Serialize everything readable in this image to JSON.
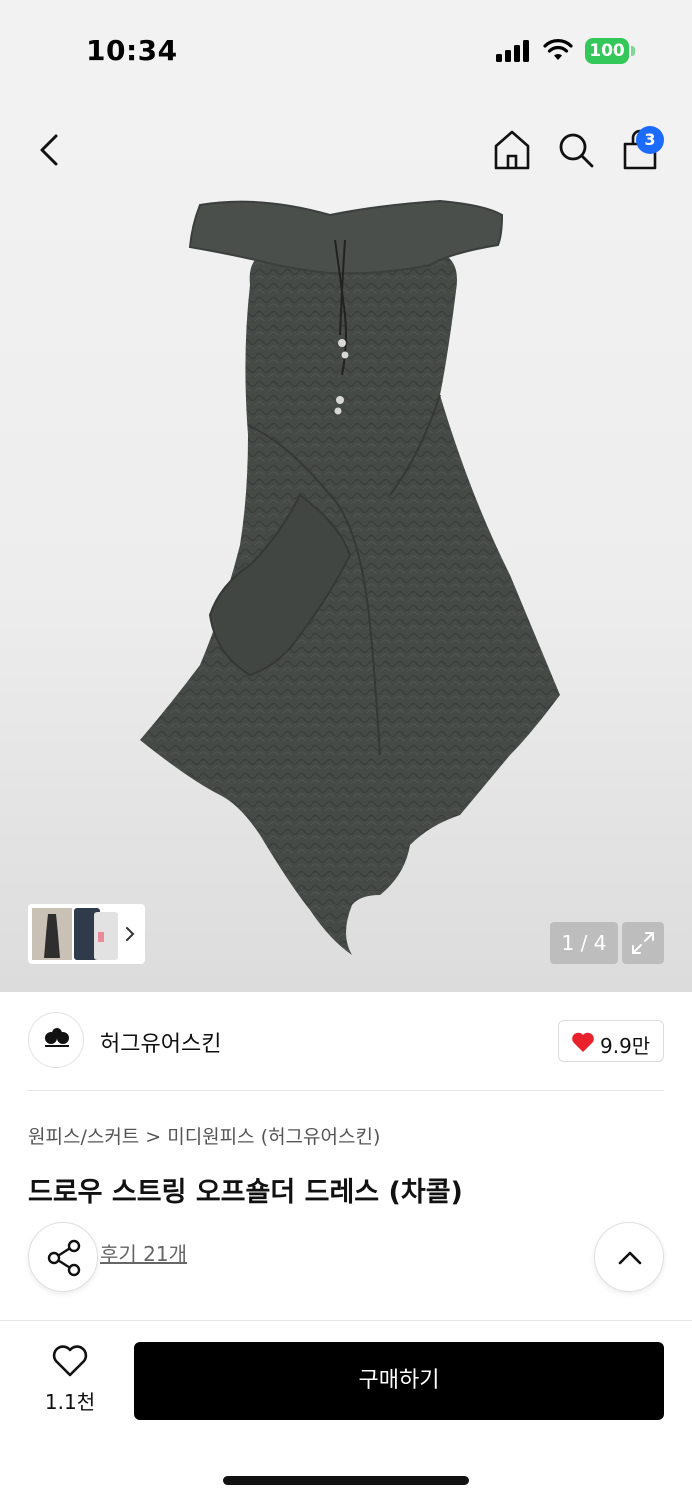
{
  "status_bar": {
    "time": "10:34",
    "battery": "100",
    "battery_color": "#34c759"
  },
  "header": {
    "icons": [
      "back-icon",
      "home-icon",
      "search-icon",
      "shopping-bag-icon"
    ],
    "cart_count": "3",
    "badge_color": "#1c6bff"
  },
  "gallery": {
    "counter": "1 / 4",
    "expand_icon": "expand-icon",
    "thumb_chevron": "chevron-right-icon"
  },
  "brand": {
    "name": "허그유어스킨",
    "likes": "9.9만",
    "heart_color": "#e8212b"
  },
  "breadcrumb": {
    "category": "원피스/스커트",
    "separator": ">",
    "subcategory": "미디원피스 (허그유어스킨)"
  },
  "product": {
    "title": "드로우 스트링 오프숄더 드레스 (차콜)",
    "review_link": "후기 21개",
    "color_swatches": [
      "charcoal",
      "gray",
      "beige"
    ]
  },
  "bottom_bar": {
    "wish_count": "1.1천",
    "buy_label": "구매하기"
  }
}
